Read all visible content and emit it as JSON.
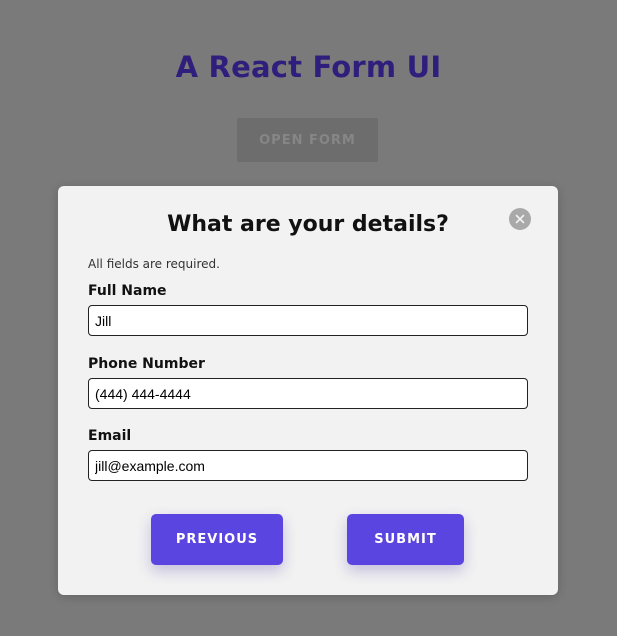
{
  "page": {
    "title": "A React Form UI",
    "open_form_label": "OPEN FORM"
  },
  "modal": {
    "title": "What are your details?",
    "close_icon": "close-icon",
    "note": "All fields are required.",
    "fields": [
      {
        "label": "Full Name",
        "value": "Jill"
      },
      {
        "label": "Phone Number",
        "value": "(444) 444-4444"
      },
      {
        "label": "Email",
        "value": "jill@example.com"
      }
    ],
    "previous_label": "PREVIOUS",
    "submit_label": "SUBMIT"
  },
  "colors": {
    "background_overlay": "#7a7a7a",
    "title_color": "#2f1e7c",
    "modal_background": "#f2f2f2",
    "accent": "#5b45e0"
  }
}
